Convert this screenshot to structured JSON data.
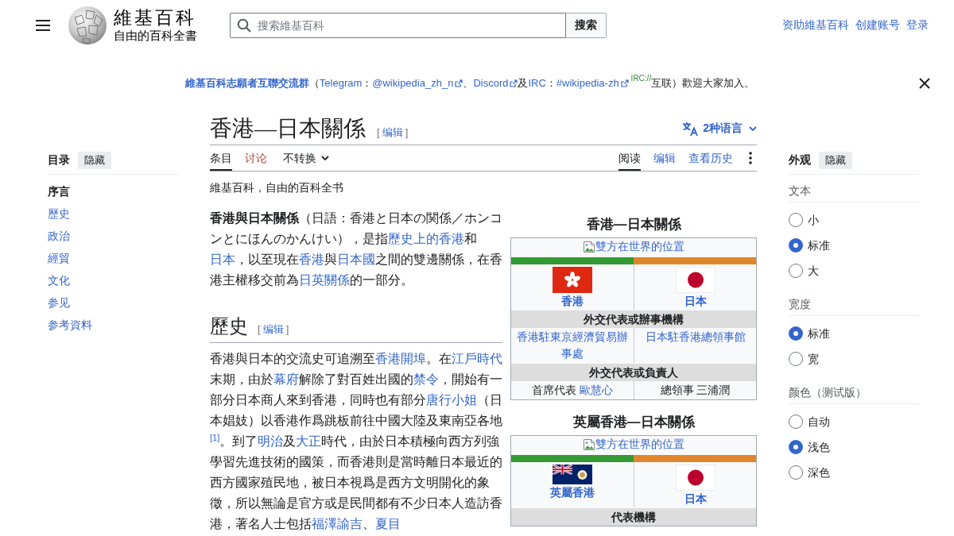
{
  "header": {
    "site_title": "維基百科",
    "site_tagline": "自由的百科全書",
    "search": {
      "placeholder": "搜索維基百科",
      "button": "搜索"
    },
    "user_links": [
      "资助維基百科",
      "创建账号",
      "登录"
    ]
  },
  "notice": {
    "segments": [
      {
        "kind": "bold-link",
        "text": "維基百科志願者互聯交流群"
      },
      {
        "kind": "text",
        "text": "（"
      },
      {
        "kind": "link",
        "text": "Telegram"
      },
      {
        "kind": "text",
        "text": "："
      },
      {
        "kind": "ext-link",
        "text": "@wikipedia_zh_n"
      },
      {
        "kind": "text",
        "text": "、"
      },
      {
        "kind": "ext-link",
        "text": "Discord"
      },
      {
        "kind": "text",
        "text": "及"
      },
      {
        "kind": "link",
        "text": "IRC"
      },
      {
        "kind": "text",
        "text": "："
      },
      {
        "kind": "ext-link",
        "text": "#wikipedia-zh"
      },
      {
        "kind": "note",
        "text": "IRC://"
      },
      {
        "kind": "text",
        "text": "互联）歡迎大家加入。"
      }
    ]
  },
  "toc": {
    "title": "目录",
    "hide_button": "隐藏",
    "items": [
      {
        "label": "序言",
        "selected": true
      },
      {
        "label": "歷史",
        "selected": false
      },
      {
        "label": "政治",
        "selected": false
      },
      {
        "label": "經貿",
        "selected": false
      },
      {
        "label": "文化",
        "selected": false
      },
      {
        "label": "参见",
        "selected": false
      },
      {
        "label": "参考資料",
        "selected": false
      }
    ]
  },
  "article": {
    "title": "香港—日本關係",
    "edit": {
      "open": "[",
      "label": "编辑",
      "close": "]"
    },
    "languages": "2种语言",
    "tabs_left": [
      {
        "kind": "tab",
        "label": "条目",
        "selected": true,
        "missing": false
      },
      {
        "kind": "tab",
        "label": "讨论",
        "selected": false,
        "missing": true
      },
      {
        "kind": "dropdown",
        "label": "不转换",
        "selected": false,
        "missing": false
      }
    ],
    "tabs_right": [
      {
        "kind": "tab",
        "label": "阅读",
        "selected": true,
        "missing": false
      },
      {
        "kind": "tab",
        "label": "编辑",
        "selected": false,
        "missing": false
      },
      {
        "kind": "tab",
        "label": "查看历史",
        "selected": false,
        "missing": false
      }
    ],
    "tagline": "維基百科，自由的百科全书",
    "lead": [
      {
        "kind": "bold",
        "text": "香港與日本關係"
      },
      {
        "kind": "text",
        "text": "（日語：香港と日本の関係／ホンコンとにほんのかんけい），是指"
      },
      {
        "kind": "link",
        "text": "歷史上的香港"
      },
      {
        "kind": "text",
        "text": "和"
      },
      {
        "kind": "link",
        "text": "日本"
      },
      {
        "kind": "text",
        "text": "，以至現在"
      },
      {
        "kind": "link",
        "text": "香港"
      },
      {
        "kind": "text",
        "text": "與"
      },
      {
        "kind": "link",
        "text": "日本國"
      },
      {
        "kind": "text",
        "text": "之間的雙邊關係，在香港主權移交前為"
      },
      {
        "kind": "link",
        "text": "日英關係"
      },
      {
        "kind": "text",
        "text": "的一部分。"
      }
    ],
    "sections": [
      {
        "heading": "歷史",
        "edit": {
          "open": "[",
          "label": "编辑",
          "close": "]"
        },
        "paragraph": [
          {
            "kind": "text",
            "text": "香港與日本的交流史可追溯至"
          },
          {
            "kind": "link",
            "text": "香港開埠"
          },
          {
            "kind": "text",
            "text": "。在"
          },
          {
            "kind": "link",
            "text": "江戶時代"
          },
          {
            "kind": "text",
            "text": "末期，由於"
          },
          {
            "kind": "link",
            "text": "幕府"
          },
          {
            "kind": "text",
            "text": "解除了對百姓出國的"
          },
          {
            "kind": "link",
            "text": "禁令"
          },
          {
            "kind": "text",
            "text": "，開始有一部分日本商人來到香港，同時也有部分"
          },
          {
            "kind": "link",
            "text": "唐行小姐"
          },
          {
            "kind": "text",
            "text": "（日本娼妓）以香港作爲跳板前往中國大陸及東南亞各地"
          },
          {
            "kind": "ref",
            "text": "[1]"
          },
          {
            "kind": "text",
            "text": "。到了"
          },
          {
            "kind": "link",
            "text": "明治"
          },
          {
            "kind": "text",
            "text": "及"
          },
          {
            "kind": "link",
            "text": "大正"
          },
          {
            "kind": "text",
            "text": "時代，由於日本積極向西方列強學習先進技術的國策，而香港則是當時離日本最近的西方國家殖民地，被日本視爲是西方文明開化的象徵，所以無論是官方或是民間都有不少日本人造訪香港，著名人士包括"
          },
          {
            "kind": "link",
            "text": "福澤諭吉"
          },
          {
            "kind": "text",
            "text": "、"
          },
          {
            "kind": "link",
            "text": "夏目"
          }
        ]
      }
    ],
    "infoboxes": [
      {
        "title": "香港—日本關係",
        "image_alt": "雙方在世界的位置",
        "sides": [
          {
            "name": "香港",
            "kind": "bauhinia",
            "color": "#339a33"
          },
          {
            "name": "日本",
            "kind": "disc",
            "color": "#e0862a"
          }
        ],
        "sections": [
          {
            "header": "外交代表或辦事機構",
            "cells": [
              [
                {
                  "kind": "link",
                  "text": "香港駐東京經濟貿易辦事處"
                }
              ],
              [
                {
                  "kind": "link",
                  "text": "日本駐香港總領事館"
                }
              ]
            ]
          },
          {
            "header": "外交代表或負責人",
            "cells": [
              [
                {
                  "kind": "text",
                  "text": "首席代表 "
                },
                {
                  "kind": "link",
                  "text": "歐慧心"
                }
              ],
              [
                {
                  "kind": "text",
                  "text": "總領事 三浦潤"
                }
              ]
            ]
          }
        ]
      },
      {
        "title": "英屬香港—日本關係",
        "image_alt": "雙方在世界的位置",
        "sides": [
          {
            "name": "英屬香港",
            "kind": "ensign",
            "color": "#339a33"
          },
          {
            "name": "日本",
            "kind": "disc",
            "color": "#e0862a"
          }
        ],
        "sections": [
          {
            "header": "代表機構"
          }
        ]
      }
    ]
  },
  "appearance": {
    "title": "外观",
    "hide_button": "隐藏",
    "groups": [
      {
        "label": "文本",
        "options": [
          {
            "label": "小",
            "selected": false
          },
          {
            "label": "标准",
            "selected": true
          },
          {
            "label": "大",
            "selected": false
          }
        ]
      },
      {
        "label": "宽度",
        "options": [
          {
            "label": "标准",
            "selected": true
          },
          {
            "label": "宽",
            "selected": false
          }
        ]
      },
      {
        "label": "颜色（测试版）",
        "options": [
          {
            "label": "自动",
            "selected": false
          },
          {
            "label": "浅色",
            "selected": true
          },
          {
            "label": "深色",
            "selected": false
          }
        ]
      }
    ]
  }
}
